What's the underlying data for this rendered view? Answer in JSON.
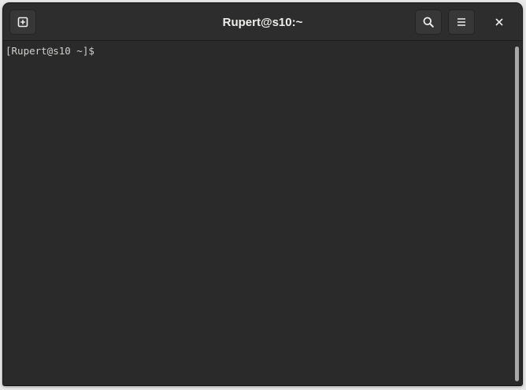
{
  "window": {
    "title": "Rupert@s10:~"
  },
  "headerbar": {
    "new_tab_icon": "new-tab-icon",
    "search_icon": "search-icon",
    "menu_icon": "hamburger-menu-icon",
    "close_icon": "close-icon"
  },
  "terminal": {
    "prompt": "[Rupert@s10 ~]$",
    "input": ""
  },
  "colors": {
    "background": "#2a2a2a",
    "headerbar": "#2d2d2d",
    "text": "#d0cfcc",
    "title": "#eeeeec"
  }
}
